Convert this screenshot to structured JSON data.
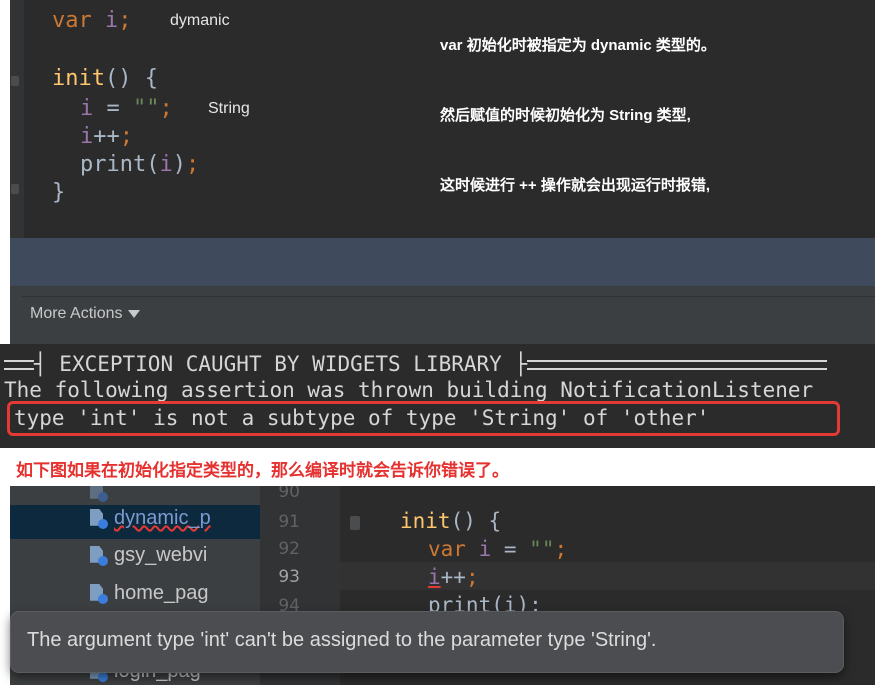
{
  "snippet1": {
    "code": {
      "l1_kw": "var",
      "l1_var": "i",
      "l1_end": ";",
      "l2_fn": "init",
      "l2_rest": "() {",
      "l3_var": "i",
      "l3_eq": " = ",
      "l3_str": "\"\"",
      "l3_end": ";",
      "l4_var": "i",
      "l4_op": "++",
      "l4_end": ";",
      "l5_fn": "print",
      "l5_open": "(",
      "l5_var": "i",
      "l5_close": ")",
      "l5_end": ";",
      "l6": "}"
    },
    "type_hints": {
      "dynamic": "dymanic",
      "string": "String"
    },
    "notes": [
      "var 初始化时被指定为 dynamic 类型的。",
      "然后赋值的时候初始化为 String 类型,",
      "这时候进行 ++ 操作就会出现运行时报错,"
    ]
  },
  "toolbar": {
    "more_actions_label": "More Actions"
  },
  "console": {
    "exception_header": "EXCEPTION CAUGHT BY WIDGETS LIBRARY",
    "assertion_line": "The following assertion was thrown building NotificationListener",
    "error_line": "type 'int' is not a subtype of type 'String' of 'other'"
  },
  "caption": "如下图如果在初始化指定类型的，那么编译时就会告诉你错误了。",
  "ide": {
    "tree_items": [
      {
        "label": "dynamic_p"
      },
      {
        "label": "gsy_webvi"
      },
      {
        "label": "home_pag"
      },
      {
        "label": "login_pag"
      }
    ],
    "line_numbers": [
      "90",
      "91",
      "92",
      "93",
      "94"
    ],
    "code": {
      "l91_fn": "init",
      "l91_rest": "() {",
      "l92_kw": "var",
      "l92_var": " i",
      "l92_eq": " = ",
      "l92_str": "\"\"",
      "l92_end": ";",
      "l93_var": "i",
      "l93_op": "++",
      "l93_end": ";",
      "l94": "print(i);"
    },
    "tooltip": "The argument type 'int' can't be assigned to the parameter type 'String'."
  },
  "colors": {
    "error_red": "#e53935",
    "keyword": "#cc7832",
    "function": "#ffc66d",
    "variable": "#9876aa",
    "string": "#6a8759"
  }
}
